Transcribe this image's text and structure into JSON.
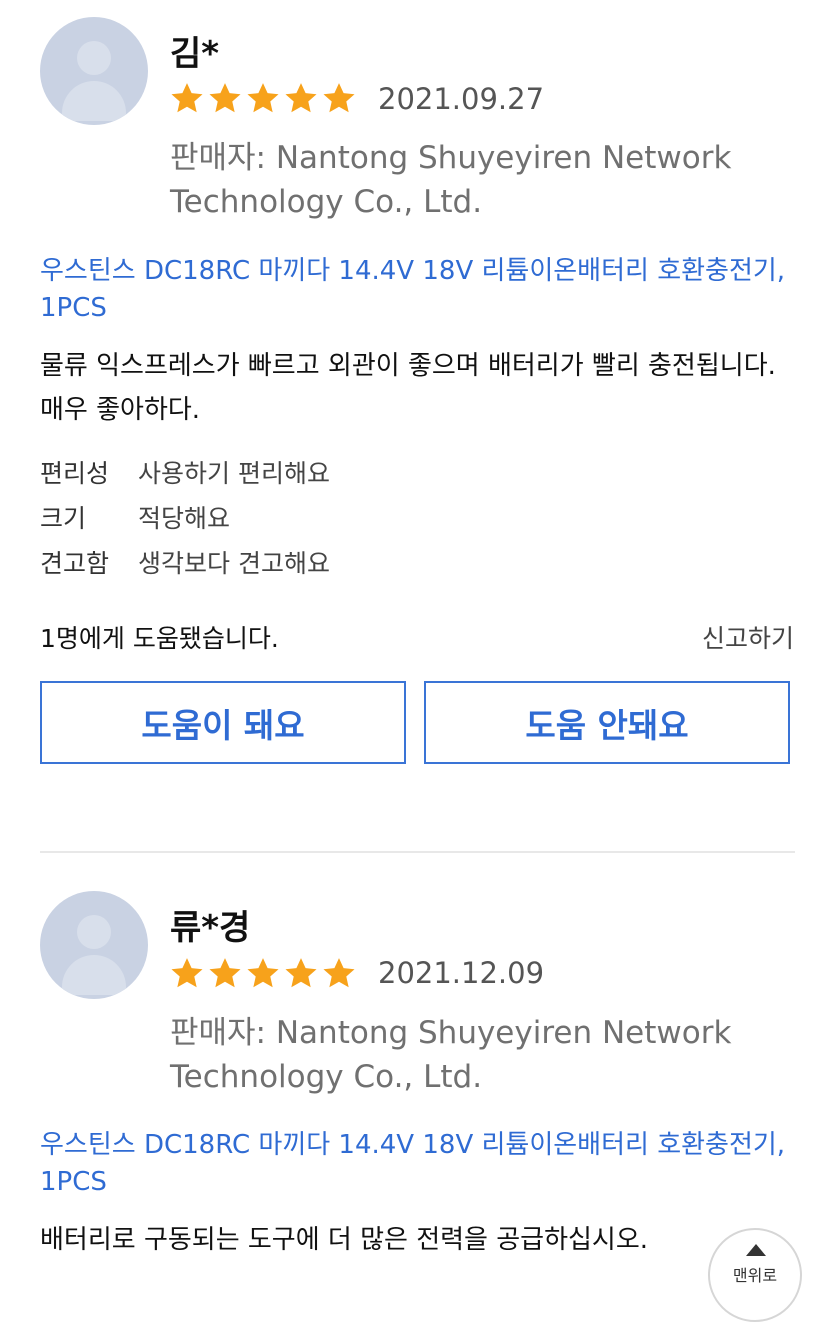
{
  "reviews": [
    {
      "name": "김*",
      "rating": 5,
      "date": "2021.09.27",
      "seller": "판매자: Nantong Shuyeyiren Network Technology Co., Ltd.",
      "product": "우스틴스 DC18RC 마끼다 14.4V 18V 리튬이온배터리 호환충전기, 1PCS",
      "content": "물류 익스프레스가 빠르고 외관이 좋으며 배터리가 빨리 충전됩니다. 매우 좋아하다.",
      "attributes": [
        {
          "key": "편리성",
          "value": "사용하기 편리해요"
        },
        {
          "key": "크기",
          "value": "적당해요"
        },
        {
          "key": "견고함",
          "value": "생각보다 견고해요"
        }
      ],
      "helpful_text": "1명에게 도움됐습니다.",
      "report_label": "신고하기",
      "helpful_button": "도움이 돼요",
      "not_helpful_button": "도움 안돼요"
    },
    {
      "name": "류*경",
      "rating": 5,
      "date": "2021.12.09",
      "seller": "판매자: Nantong Shuyeyiren Network Technology Co., Ltd.",
      "product": "우스틴스 DC18RC 마끼다 14.4V 18V 리튬이온배터리 호환충전기, 1PCS",
      "content": "배터리로 구동되는 도구에 더 많은 전력을 공급하십시오."
    }
  ],
  "top_button_label": "맨위로",
  "colors": {
    "star": "#f7a21b",
    "accent": "#2f6bd3",
    "avatar": "#c9d2e3"
  },
  "icons": {
    "avatar": "user-avatar-placeholder",
    "star": "star-icon",
    "scroll_top": "arrow-up-icon"
  }
}
